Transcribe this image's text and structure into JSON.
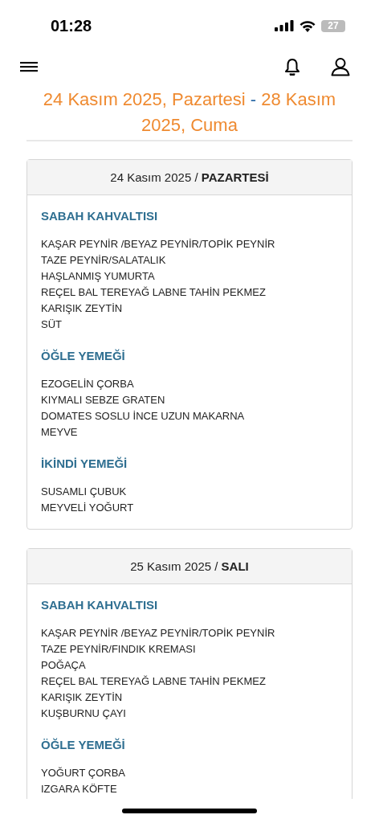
{
  "status_bar": {
    "time": "01:28",
    "battery": "27"
  },
  "title": {
    "start": "24 Kasım 2025, Pazartesi",
    "separator": "-",
    "end": "28 Kasım 2025, Cuma"
  },
  "days": [
    {
      "heading": "24 Kasım 2025 / **PAZARTESİ**",
      "meals": [
        {
          "name": "SABAH KAHVALTISI",
          "items": [
            "KAŞAR PEYNİR /BEYAZ PEYNİR/TOPİK PEYNİR",
            "TAZE PEYNİR/SALATALIK",
            "HAŞLANMIŞ YUMURTA",
            "REÇEL BAL TEREYAĞ LABNE TAHİN PEKMEZ",
            "KARIŞIK ZEYTİN",
            "SÜT"
          ]
        },
        {
          "name": "ÖĞLE YEMEĞİ",
          "items": [
            "EZOGELİN ÇORBA",
            "KIYMALI SEBZE GRATEN",
            "DOMATES SOSLU İNCE UZUN MAKARNA",
            "MEYVE"
          ]
        },
        {
          "name": "İKİNDİ YEMEĞİ",
          "items": [
            "SUSAMLI ÇUBUK",
            "MEYVELİ YOĞURT"
          ]
        }
      ]
    },
    {
      "heading": "25 Kasım 2025 / **SALI**",
      "meals": [
        {
          "name": "SABAH KAHVALTISI",
          "items": [
            "KAŞAR PEYNİR /BEYAZ PEYNİR/TOPİK PEYNİR",
            "TAZE PEYNİR/FINDIK KREMASI",
            "POĞAÇA",
            "REÇEL BAL TEREYAĞ LABNE TAHİN PEKMEZ",
            "KARIŞIK ZEYTİN",
            "KUŞBURNU ÇAYI"
          ]
        },
        {
          "name": "ÖĞLE YEMEĞİ",
          "items": [
            "YOĞURT ÇORBA",
            "IZGARA KÖFTE"
          ]
        }
      ]
    }
  ]
}
